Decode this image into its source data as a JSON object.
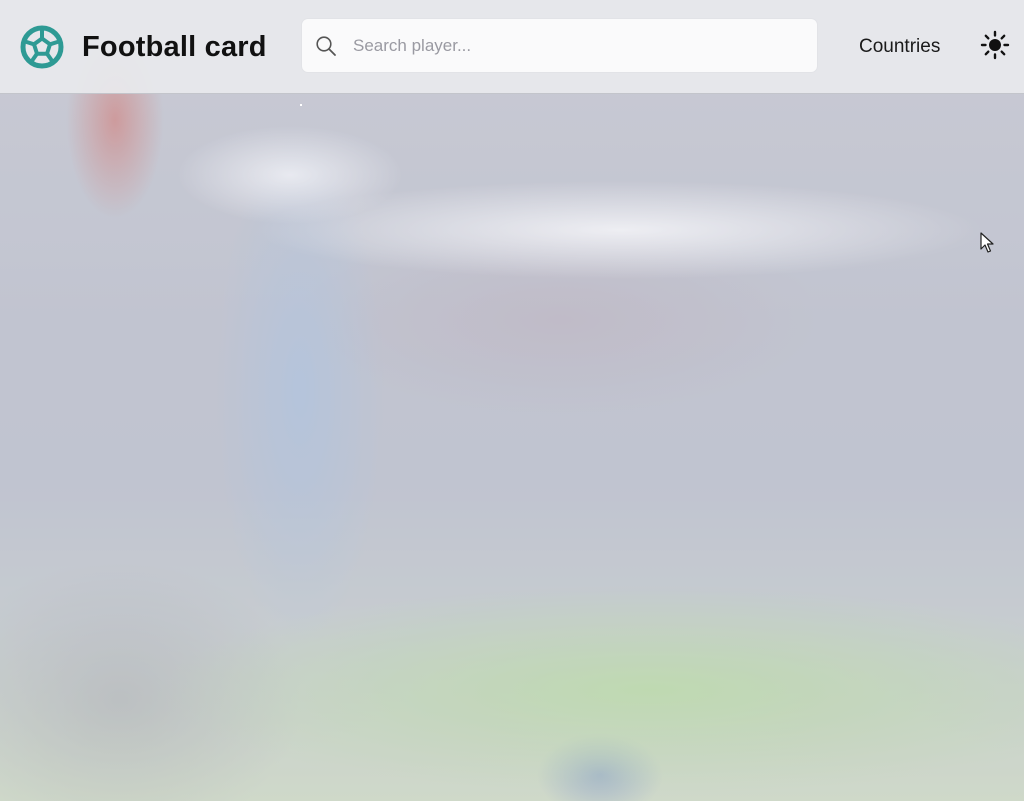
{
  "app": {
    "title": "Football card",
    "logo_icon": "soccer-ball-icon",
    "accent_color": "#2e9a94"
  },
  "search": {
    "placeholder": "Search player...",
    "value": "",
    "icon": "search-icon"
  },
  "nav": {
    "countries_label": "Countries"
  },
  "theme_toggle": {
    "icon": "sun-icon"
  },
  "background": {
    "description_icon": "stadium-background-image"
  }
}
